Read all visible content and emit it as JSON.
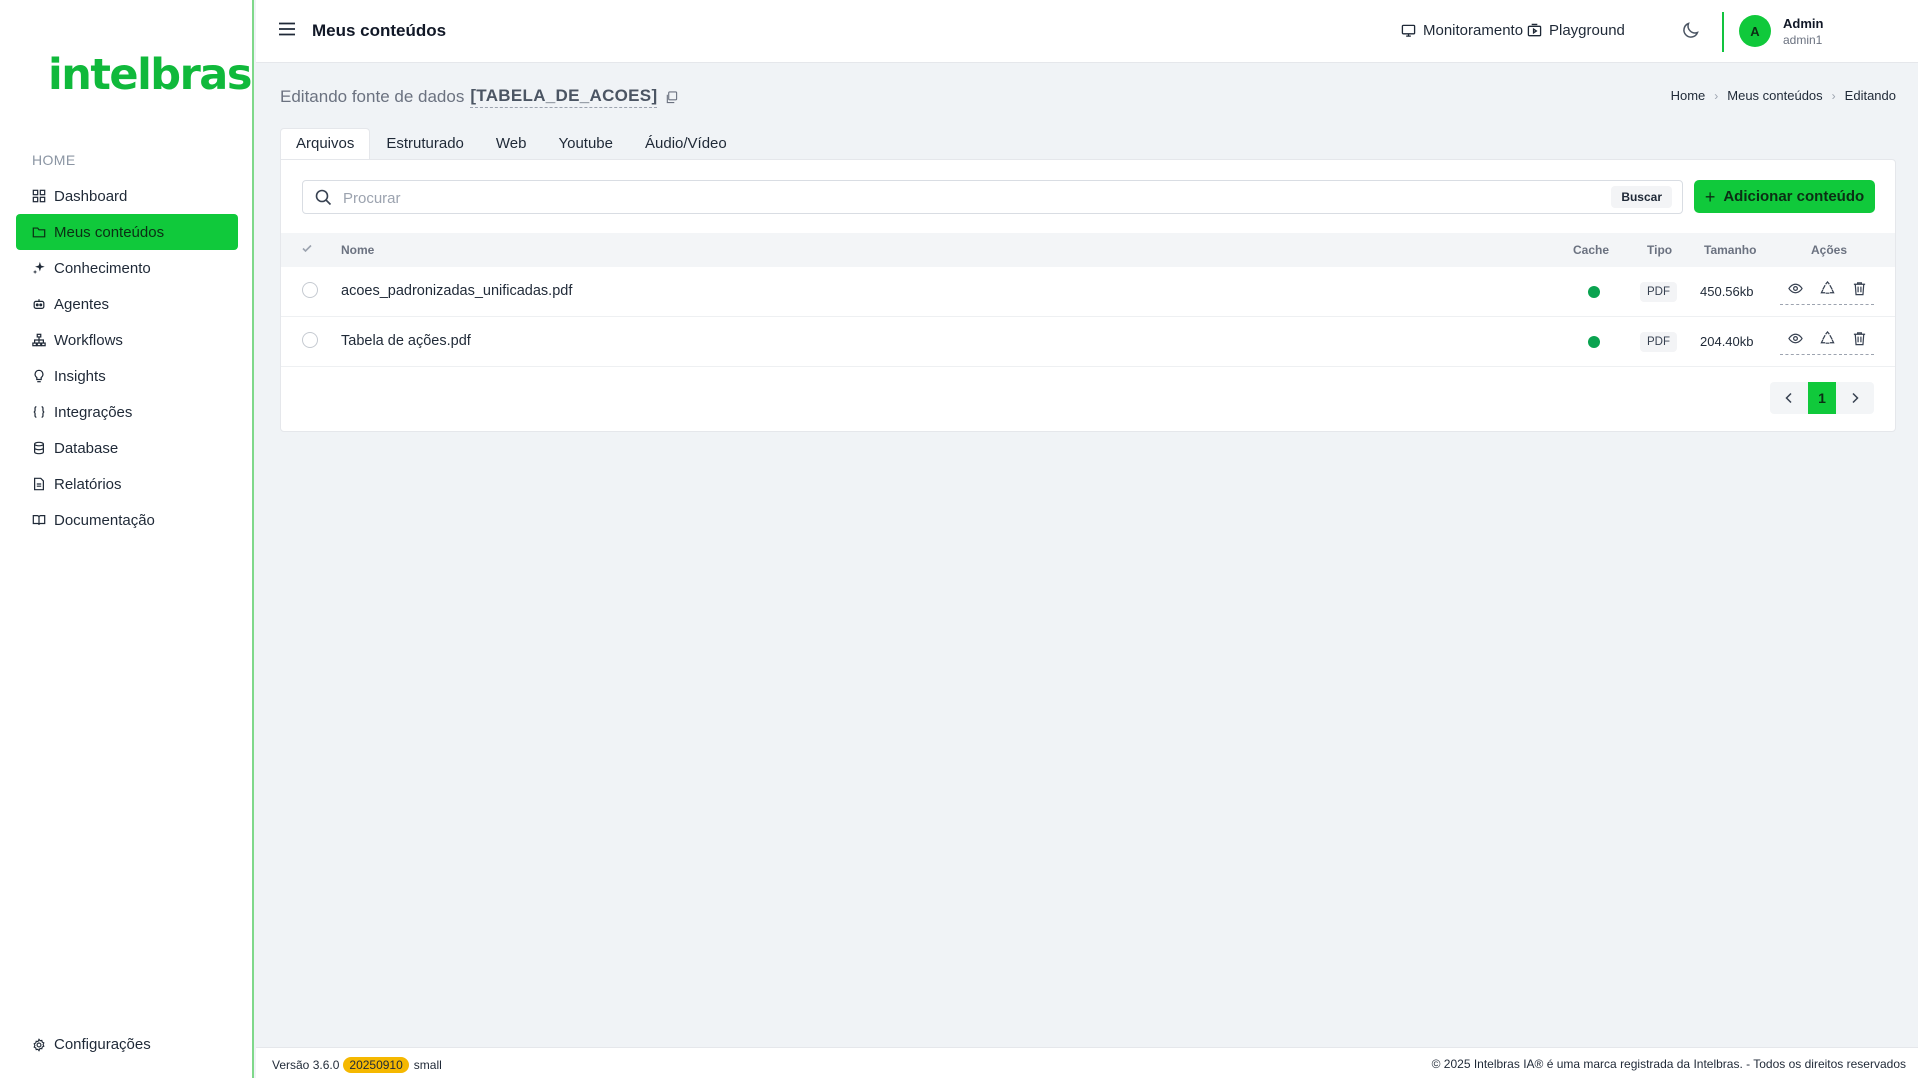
{
  "brand": {
    "logo_text": "intelbras",
    "accent": "#10c93b"
  },
  "sidebar": {
    "section_title": "HOME",
    "items": [
      {
        "label": "Dashboard",
        "icon": "grid-icon"
      },
      {
        "label": "Meus conteúdos",
        "icon": "folder-icon",
        "active": true
      },
      {
        "label": "Conhecimento",
        "icon": "sparkle-icon"
      },
      {
        "label": "Agentes",
        "icon": "robot-icon"
      },
      {
        "label": "Workflows",
        "icon": "sitemap-icon"
      },
      {
        "label": "Insights",
        "icon": "lightbulb-icon"
      },
      {
        "label": "Integrações",
        "icon": "braces-icon"
      },
      {
        "label": "Database",
        "icon": "database-icon"
      },
      {
        "label": "Relatórios",
        "icon": "report-icon"
      },
      {
        "label": "Documentação",
        "icon": "book-icon"
      }
    ],
    "settings_label": "Configurações"
  },
  "header": {
    "title": "Meus conteúdos",
    "links": [
      {
        "label": "Monitoramento",
        "icon": "monitor-icon"
      },
      {
        "label": "Playground",
        "icon": "playground-icon"
      }
    ],
    "user": {
      "initial": "A",
      "name": "Admin",
      "username": "admin1"
    }
  },
  "page": {
    "heading_prefix": "Editando fonte de dados",
    "datasource": "[TABELA_DE_ACOES]",
    "breadcrumb": [
      "Home",
      "Meus conteúdos",
      "Editando"
    ]
  },
  "tabs": [
    "Arquivos",
    "Estruturado",
    "Web",
    "Youtube",
    "Áudio/Vídeo"
  ],
  "search": {
    "placeholder": "Procurar",
    "button": "Buscar"
  },
  "add_button": "Adicionar conteúdo",
  "table": {
    "headers": {
      "name": "Nome",
      "cache": "Cache",
      "type": "Tipo",
      "size": "Tamanho",
      "actions": "Ações"
    },
    "rows": [
      {
        "name": "acoes_padronizadas_unificadas.pdf",
        "cached": true,
        "type": "PDF",
        "size": "450.56kb"
      },
      {
        "name": "Tabela de ações.pdf",
        "cached": true,
        "type": "PDF",
        "size": "204.40kb"
      }
    ]
  },
  "pagination": {
    "current": "1"
  },
  "footer": {
    "version": "Versão 3.6.0",
    "build": "20250910",
    "size": "small",
    "copyright": "© 2025 Intelbras IA® é uma marca registrada da Intelbras. - Todos os direitos reservados"
  }
}
